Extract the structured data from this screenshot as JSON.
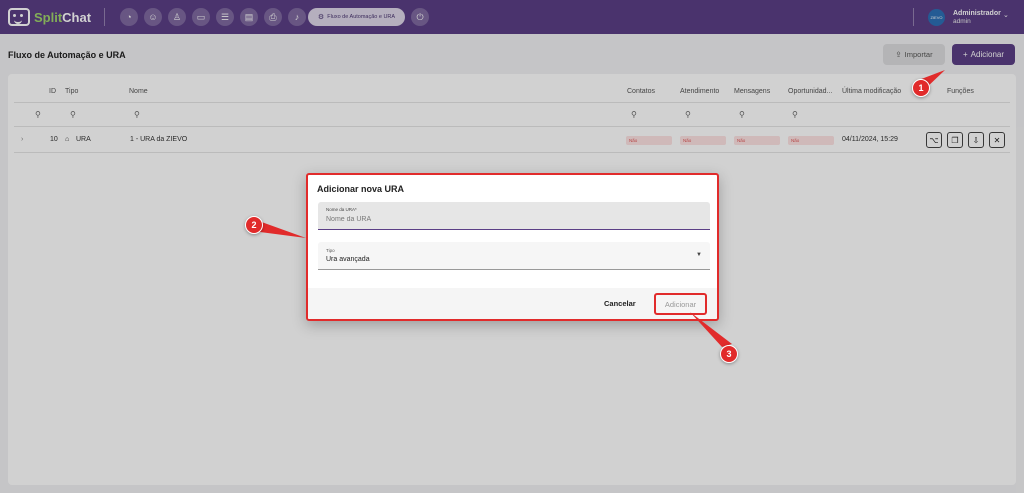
{
  "topbar": {
    "logo": {
      "split": "Split",
      "chat": "Chat"
    },
    "nav_icons": [
      "dashboard-icon",
      "contacts-icon",
      "user-add-icon",
      "chat-icon",
      "list-icon",
      "document-icon",
      "print-icon",
      "bell-icon"
    ],
    "active_tab": "Fluxo de Automação e URA",
    "user": {
      "avatar_text": "ZIEVO",
      "name": "Administrador",
      "role": "admin"
    }
  },
  "page": {
    "title": "Fluxo de Automação e URA",
    "import_label": "Importar",
    "add_label": "Adicionar"
  },
  "table": {
    "headers": {
      "id": "ID",
      "tipo": "Tipo",
      "nome": "Nome",
      "contatos": "Contatos",
      "atendimento": "Atendimento",
      "mensagens": "Mensagens",
      "oportunidade": "Oportunidad...",
      "ultima": "Última modificação",
      "funcoes": "Funções"
    },
    "row": {
      "id": "10",
      "tipo": "URA",
      "nome": "1 - URA da ZIEVO",
      "contatos": "Não",
      "atendimento": "Não",
      "mensagens": "Não",
      "oportunidade": "Não",
      "ultima": "04/11/2024, 15:29"
    }
  },
  "dialog": {
    "title": "Adicionar nova URA",
    "name_label": "Nome da URA*",
    "name_placeholder": "Nome da URA",
    "tipo_label": "Tipo",
    "tipo_value": "Ura avançada",
    "cancel_label": "Cancelar",
    "add_label": "Adicionar"
  },
  "annotations": {
    "marker_1": "1",
    "marker_2": "2",
    "marker_3": "3",
    "marker_color": "#e12b2b"
  },
  "colors": {
    "brand": "#5b3f86",
    "accent_green": "#9fd36b",
    "negative_badge": "#fde2e2"
  }
}
